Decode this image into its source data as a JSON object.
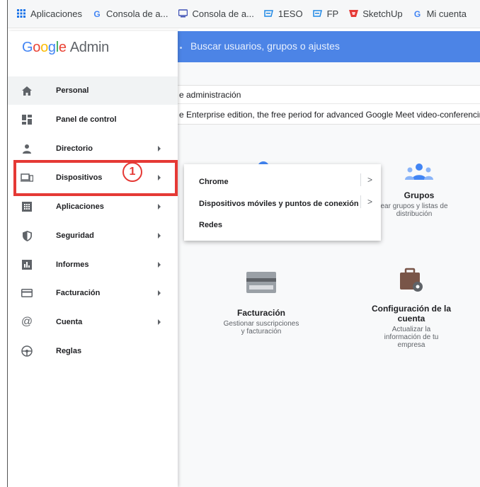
{
  "bookmarks": [
    {
      "icon": "apps-grid-icon",
      "label": "Aplicaciones",
      "color": "#1a73e8"
    },
    {
      "icon": "google-g-icon",
      "label": "Consola de a...",
      "color": "#4285f4"
    },
    {
      "icon": "console-icon",
      "label": "Consola de a...",
      "color": "#3f51b5"
    },
    {
      "icon": "classroom-icon",
      "label": "1ESO",
      "color": "#1e88e5"
    },
    {
      "icon": "classroom-icon",
      "label": "FP",
      "color": "#1e88e5"
    },
    {
      "icon": "sketchup-icon",
      "label": "SketchUp",
      "color": "#e53935"
    },
    {
      "icon": "google-g-icon",
      "label": "Mi cuenta",
      "color": "#4285f4"
    }
  ],
  "logo": {
    "brand": "Google",
    "product": "Admin"
  },
  "search": {
    "placeholder": "Buscar usuarios, grupos o ajustes"
  },
  "main": {
    "admin_text": "e administración",
    "notice_text": "e Enterprise edition, the free period for advanced Google Meet video-conferencing"
  },
  "cards": {
    "grupos": {
      "title": "Grupos",
      "desc_line1": "ear grupos y listas de",
      "desc_line2": "distribución"
    },
    "facturacion": {
      "title": "Facturación",
      "desc_line1": "Gestionar suscripciones",
      "desc_line2": "y facturación"
    },
    "config": {
      "title_line1": "Configuración de la",
      "title_line2": "cuenta",
      "desc_line1": "Actualizar la",
      "desc_line2": "información de tu",
      "desc_line3": "empresa"
    }
  },
  "sidebar": {
    "items": [
      {
        "label": "Personal",
        "icon": "home-icon",
        "arrow": false
      },
      {
        "label": "Panel de control",
        "icon": "dashboard-icon",
        "arrow": false
      },
      {
        "label": "Directorio",
        "icon": "person-icon",
        "arrow": true
      },
      {
        "label": "Dispositivos",
        "icon": "devices-icon",
        "arrow": true
      },
      {
        "label": "Aplicaciones",
        "icon": "apps-icon",
        "arrow": true
      },
      {
        "label": "Seguridad",
        "icon": "shield-icon",
        "arrow": true
      },
      {
        "label": "Informes",
        "icon": "reports-icon",
        "arrow": true
      },
      {
        "label": "Facturación",
        "icon": "billing-icon",
        "arrow": true
      },
      {
        "label": "Cuenta",
        "icon": "at-icon",
        "arrow": true
      },
      {
        "label": "Reglas",
        "icon": "rules-icon",
        "arrow": false
      }
    ]
  },
  "annotation": {
    "step": "1",
    "color": "#e53935"
  },
  "submenu": {
    "items": [
      {
        "label": "Chrome",
        "chevron": ">"
      },
      {
        "label": "Dispositivos móviles y puntos de conexión",
        "chevron": ">"
      },
      {
        "label": "Redes"
      }
    ]
  }
}
